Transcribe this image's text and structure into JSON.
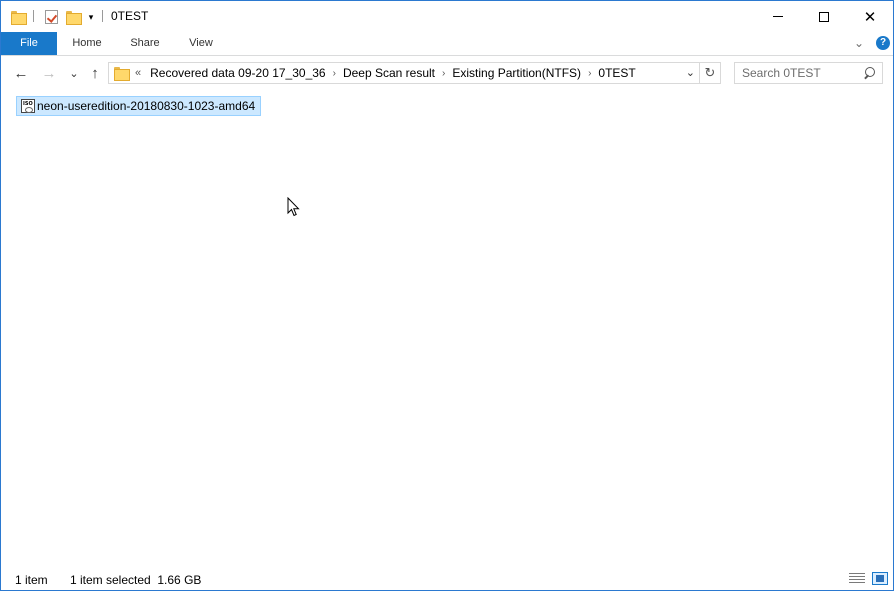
{
  "window": {
    "title": "0TEST",
    "controls": {
      "minimize_icon": "minimize-icon",
      "maximize_icon": "maximize-icon",
      "close_glyph": "✕"
    }
  },
  "quick_access": {
    "items": [
      "folder-icon",
      "properties-icon",
      "new-folder-icon"
    ],
    "dropdown_glyph": "▾"
  },
  "ribbon": {
    "tabs": [
      {
        "label": "File",
        "active": true
      },
      {
        "label": "Home"
      },
      {
        "label": "Share"
      },
      {
        "label": "View"
      }
    ],
    "expand_glyph": "⌄",
    "help_glyph": "?"
  },
  "navigation": {
    "back_glyph": "←",
    "forward_glyph": "→",
    "recent_glyph": "⌄",
    "up_glyph": "↑",
    "breadcrumb_overflow": "«",
    "breadcrumbs": [
      "Recovered data 09-20 17_30_36",
      "Deep Scan result",
      "Existing Partition(NTFS)",
      "0TEST"
    ],
    "breadcrumb_separator": "›",
    "address_dropdown_glyph": "⌄",
    "refresh_glyph": "↻"
  },
  "search": {
    "placeholder": "Search 0TEST",
    "value": ""
  },
  "files": [
    {
      "name": "neon-useredition-20180830-1023-amd64",
      "icon": "iso-file-icon",
      "icon_text": "ISO",
      "selected": true
    }
  ],
  "status": {
    "item_count": "1 item",
    "selection": "1 item selected  1.66 GB"
  },
  "colors": {
    "accent": "#1979ca",
    "selection_bg": "#cce8ff",
    "selection_border": "#99d1ff",
    "window_border": "#2b79d0"
  }
}
